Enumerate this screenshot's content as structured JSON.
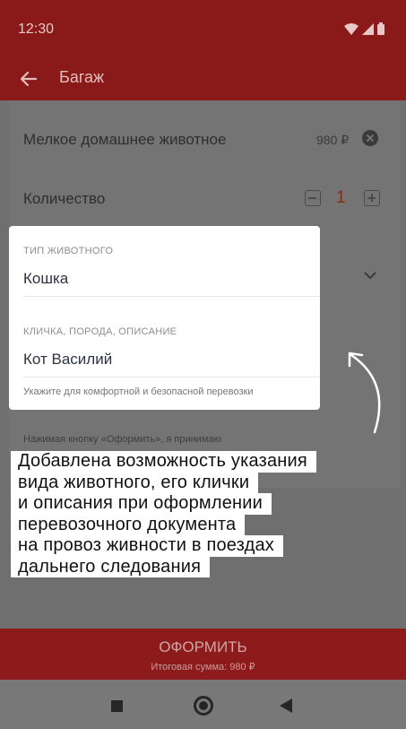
{
  "status_bar": {
    "time": "12:30",
    "icons": [
      "wifi-icon",
      "signal-icon",
      "battery-icon"
    ]
  },
  "app_bar": {
    "title": "Багаж",
    "back_icon": "arrow-left-icon"
  },
  "form": {
    "pet_item_label": "Мелкое домашнее животное",
    "pet_item_price": "980 ₽",
    "quantity_label": "Количество",
    "quantity_value": "1",
    "agreement_text": "Нажимая кнопку «Оформить», я принимаю"
  },
  "popup": {
    "animal_type_label": "ТИП ЖИВОТНОГО",
    "animal_type_value": "Кошка",
    "name_label": "КЛИЧКА, ПОРОДА, ОПИСАНИЕ",
    "name_value": "Кот Василий",
    "hint": "Укажите для комфортной и безопасной перевозки"
  },
  "caption": {
    "lines": [
      "Добавлена возможность указания",
      "вида животного, его клички",
      "и описания при оформлении",
      "перевозочного документа",
      "на провоз живности в поездах",
      "дальнего следования"
    ]
  },
  "order_button": {
    "label": "ОФОРМИТЬ",
    "total": "Итоговая сумма: 980 ₽"
  },
  "colors": {
    "brand_red": "#8a1a1a",
    "quantity_accent": "#8a2a10",
    "card_background": "#ffffff"
  }
}
